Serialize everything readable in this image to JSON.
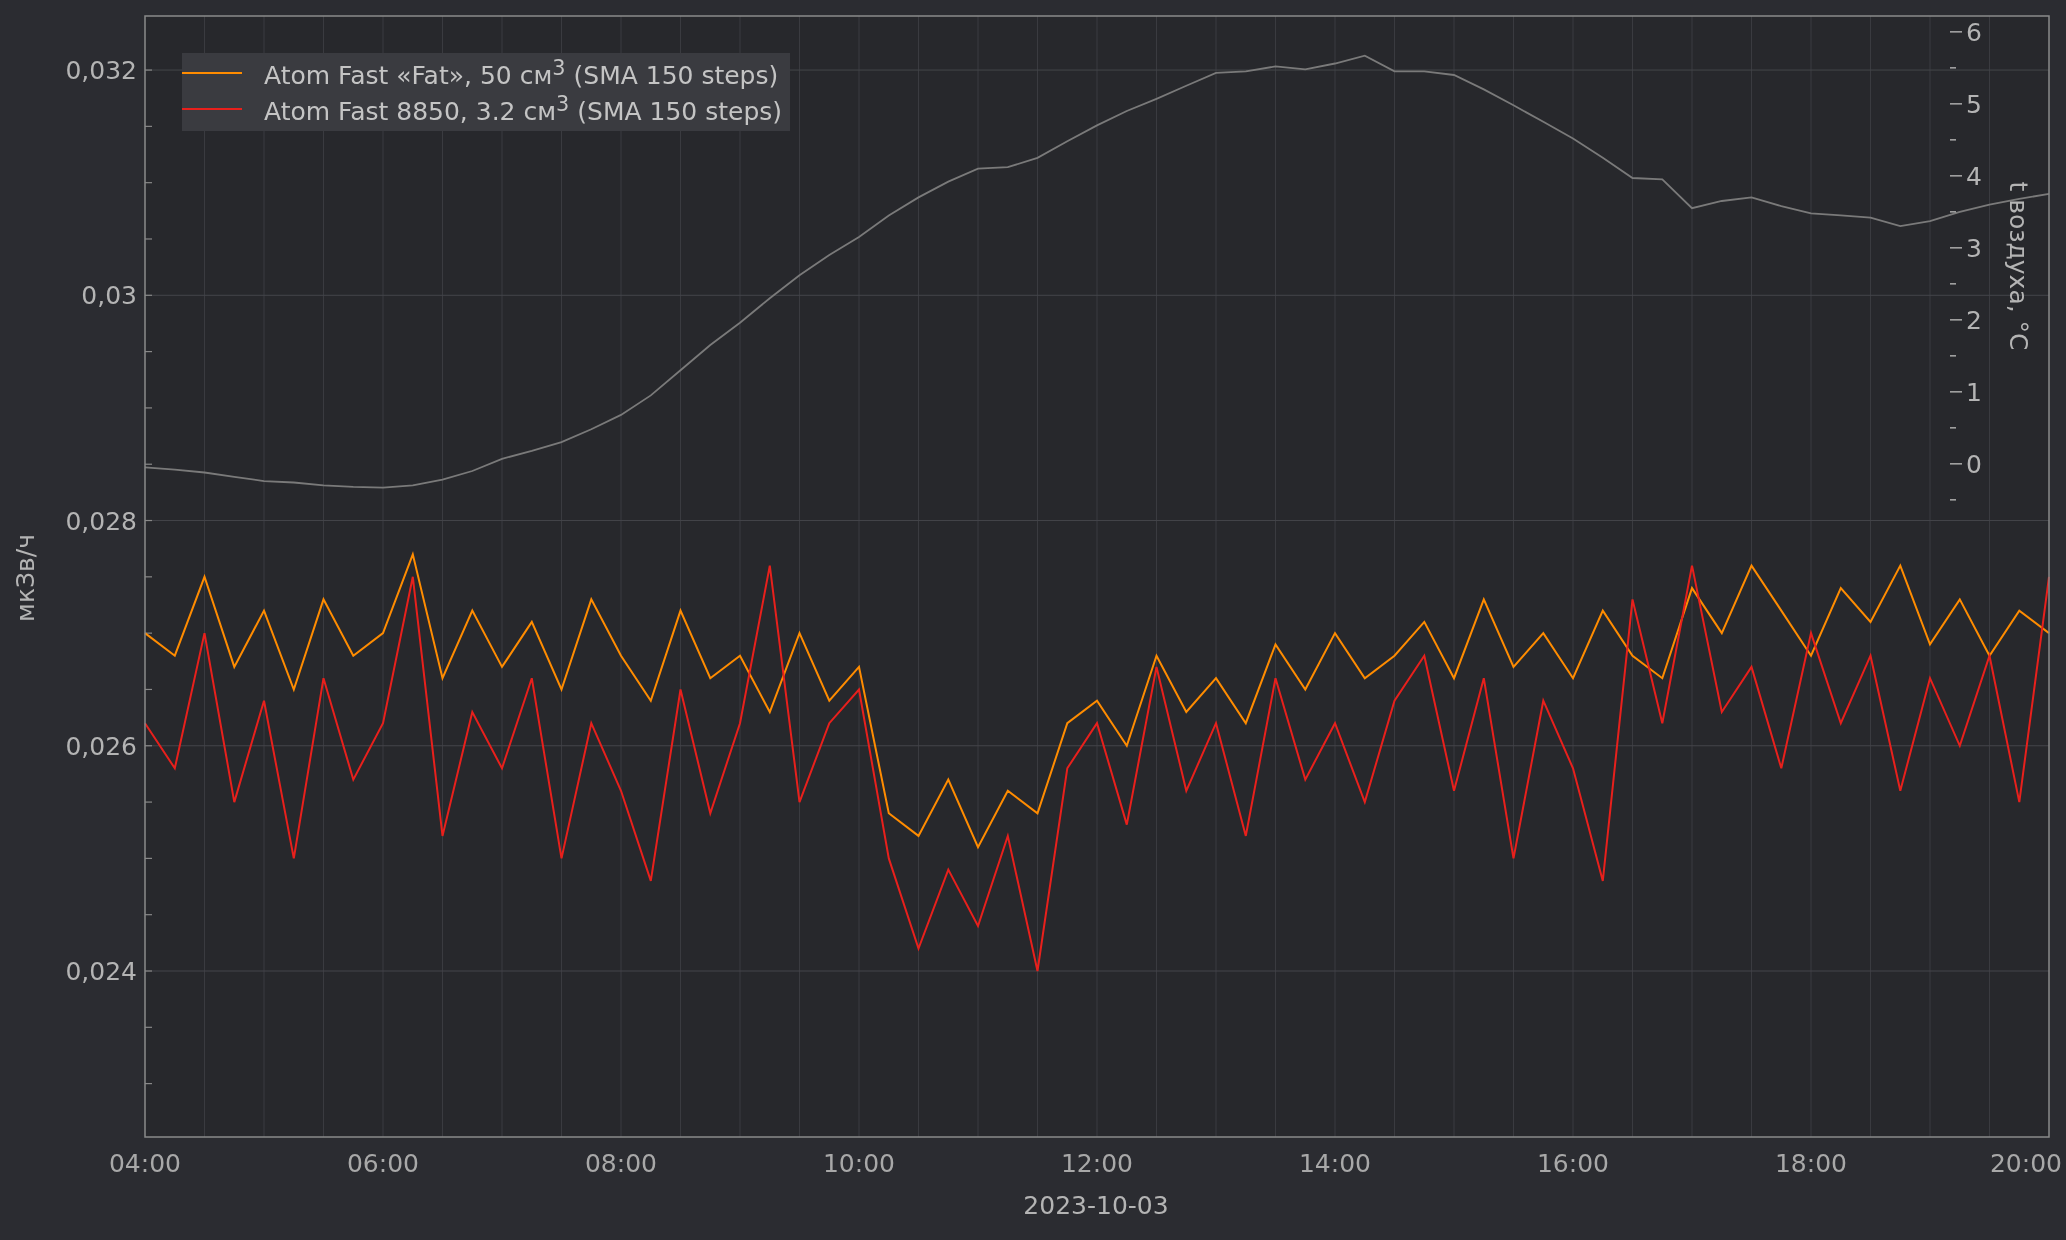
{
  "chart": {
    "chart_data": {
      "type": "line",
      "grid": true,
      "legend": true,
      "xlabel": "2023-10-03",
      "ylabel": "мкЗв/ч",
      "y2label": "t воздуха, °C",
      "xlim": [
        4,
        20
      ],
      "ylim": [
        0.022526,
        0.03248
      ],
      "y2lim": [
        -9.35,
        6.22
      ],
      "xticks": [
        {
          "value": 4,
          "label": "04:00"
        },
        {
          "value": 6,
          "label": "06:00"
        },
        {
          "value": 8,
          "label": "08:00"
        },
        {
          "value": 10,
          "label": "10:00"
        },
        {
          "value": 12,
          "label": "12:00"
        },
        {
          "value": 14,
          "label": "14:00"
        },
        {
          "value": 16,
          "label": "16:00"
        },
        {
          "value": 18,
          "label": "18:00"
        },
        {
          "value": 20,
          "label": "20:00"
        }
      ],
      "yticks": [
        {
          "value": 0.024,
          "label": "0,024"
        },
        {
          "value": 0.026,
          "label": "0,026"
        },
        {
          "value": 0.028,
          "label": "0,028"
        },
        {
          "value": 0.03,
          "label": "0,03"
        },
        {
          "value": 0.032,
          "label": "0,032"
        }
      ],
      "y2ticks": [
        0,
        1,
        2,
        3,
        4,
        5,
        6
      ],
      "x": [
        4,
        4.25,
        4.5,
        4.75,
        5,
        5.25,
        5.5,
        5.75,
        6,
        6.25,
        6.5,
        6.75,
        7,
        7.25,
        7.5,
        7.75,
        8,
        8.25,
        8.5,
        8.75,
        9,
        9.25,
        9.5,
        9.75,
        10,
        10.25,
        10.5,
        10.75,
        11,
        11.25,
        11.5,
        11.75,
        12,
        12.25,
        12.5,
        12.75,
        13,
        13.25,
        13.5,
        13.75,
        14,
        14.25,
        14.5,
        14.75,
        15,
        15.25,
        15.5,
        15.75,
        16,
        16.25,
        16.5,
        16.75,
        17,
        17.25,
        17.5,
        17.75,
        18,
        18.25,
        18.5,
        18.75,
        19,
        19.25,
        19.5,
        19.75,
        20
      ],
      "series": [
        {
          "name": "Atom Fast «Fat», 50 см$^{3}$ (SMA 150 steps)",
          "color": "#ff8c00",
          "axis": "y",
          "values": [
            0.027,
            0.0268,
            0.0275,
            0.0267,
            0.0272,
            0.0265,
            0.0273,
            0.0268,
            0.027,
            0.0277,
            0.0266,
            0.0272,
            0.0267,
            0.0271,
            0.0265,
            0.0273,
            0.0268,
            0.0264,
            0.0272,
            0.0266,
            0.0268,
            0.0263,
            0.027,
            0.0264,
            0.0267,
            0.0254,
            0.0252,
            0.0257,
            0.0251,
            0.0256,
            0.0254,
            0.0262,
            0.0264,
            0.026,
            0.0268,
            0.0263,
            0.0266,
            0.0262,
            0.0269,
            0.0265,
            0.027,
            0.0266,
            0.0268,
            0.0271,
            0.0266,
            0.0273,
            0.0267,
            0.027,
            0.0266,
            0.0272,
            0.0268,
            0.0266,
            0.0274,
            0.027,
            0.0276,
            0.0272,
            0.0268,
            0.0274,
            0.0271,
            0.0276,
            0.0269,
            0.0273,
            0.0268,
            0.0272,
            0.027
          ]
        },
        {
          "name": "Atom Fast 8850, 3.2 см$^{3}$ (SMA 150 steps)",
          "color": "#e8201c",
          "axis": "y",
          "values": [
            0.0262,
            0.0258,
            0.027,
            0.0255,
            0.0264,
            0.025,
            0.0266,
            0.0257,
            0.0262,
            0.0275,
            0.0252,
            0.0263,
            0.0258,
            0.0266,
            0.025,
            0.0262,
            0.0256,
            0.0248,
            0.0265,
            0.0254,
            0.0262,
            0.0276,
            0.0255,
            0.0262,
            0.0265,
            0.025,
            0.0242,
            0.0249,
            0.0244,
            0.0252,
            0.024,
            0.0258,
            0.0262,
            0.0253,
            0.0267,
            0.0256,
            0.0262,
            0.0252,
            0.0266,
            0.0257,
            0.0262,
            0.0255,
            0.0264,
            0.0268,
            0.0256,
            0.0266,
            0.025,
            0.0264,
            0.0258,
            0.0248,
            0.0273,
            0.0262,
            0.0276,
            0.0263,
            0.0267,
            0.0258,
            0.027,
            0.0262,
            0.0268,
            0.0256,
            0.0266,
            0.026,
            0.0268,
            0.0255,
            0.0275
          ]
        },
        {
          "color": "#7a7a7a",
          "axis": "y2",
          "values": [
            -0.05,
            -0.08,
            -0.12,
            -0.18,
            -0.24,
            -0.26,
            -0.3,
            -0.32,
            -0.33,
            -0.3,
            -0.22,
            -0.1,
            0.07,
            0.18,
            0.3,
            0.48,
            0.68,
            0.95,
            1.3,
            1.65,
            1.96,
            2.3,
            2.62,
            2.9,
            3.15,
            3.45,
            3.7,
            3.92,
            4.1,
            4.12,
            4.25,
            4.48,
            4.7,
            4.9,
            5.07,
            5.25,
            5.43,
            5.45,
            5.52,
            5.48,
            5.56,
            5.67,
            5.45,
            5.45,
            5.4,
            5.2,
            4.98,
            4.75,
            4.52,
            4.25,
            3.97,
            3.95,
            3.55,
            3.65,
            3.7,
            3.58,
            3.48,
            3.45,
            3.42,
            3.3,
            3.37,
            3.5,
            3.6,
            3.68,
            3.75
          ]
        }
      ]
    }
  }
}
